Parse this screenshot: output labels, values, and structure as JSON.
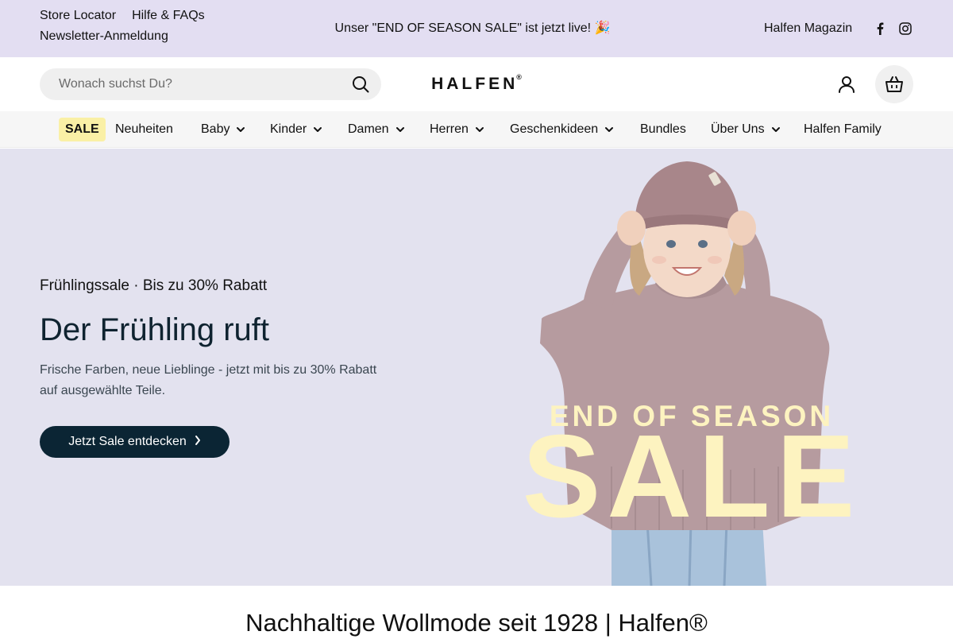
{
  "topbar": {
    "links": [
      "Store Locator",
      "Hilfe & FAQs",
      "Newsletter-Anmeldung"
    ],
    "announcement": "Unser \"END OF SEASON SALE\" ist jetzt live! 🎉",
    "magazin": "Halfen Magazin",
    "social_icons": [
      "facebook-icon",
      "instagram-icon"
    ]
  },
  "header": {
    "search_placeholder": "Wonach suchst Du?",
    "logo_text": "HALFEN",
    "logo_mark": "®",
    "icons": [
      "search-icon",
      "user-icon",
      "shopping-bag-icon"
    ]
  },
  "nav": {
    "sale_label": "SALE",
    "items": [
      {
        "label": "Neuheiten",
        "dropdown": false
      },
      {
        "label": "Baby",
        "dropdown": true
      },
      {
        "label": "Kinder",
        "dropdown": true
      },
      {
        "label": "Damen",
        "dropdown": true
      },
      {
        "label": "Herren",
        "dropdown": true
      },
      {
        "label": "Geschenkideen",
        "dropdown": true
      },
      {
        "label": "Bundles",
        "dropdown": false
      },
      {
        "label": "Über Uns",
        "dropdown": true
      },
      {
        "label": "Halfen Family",
        "dropdown": false
      }
    ]
  },
  "hero": {
    "eyebrow": "Frühlingssale · Bis zu 30% Rabatt",
    "title": "Der Frühling ruft",
    "subtitle": "Frische Farben, neue Lieblinge - jetzt mit bis zu 30% Rabatt auf ausgewählte Teile.",
    "cta_label": "Jetzt Sale entdecken",
    "image_text_top": "END OF SEASON",
    "image_text_big": "SALE"
  },
  "tagline": "Nachhaltige Wollmode seit 1928 | Halfen®",
  "colors": {
    "topbar_bg": "#e3def2",
    "hero_bg": "#e3e2ef",
    "cta_bg": "#0b2534",
    "sale_badge_bg": "#faf0a6",
    "sale_text": "#fdf3c0"
  }
}
